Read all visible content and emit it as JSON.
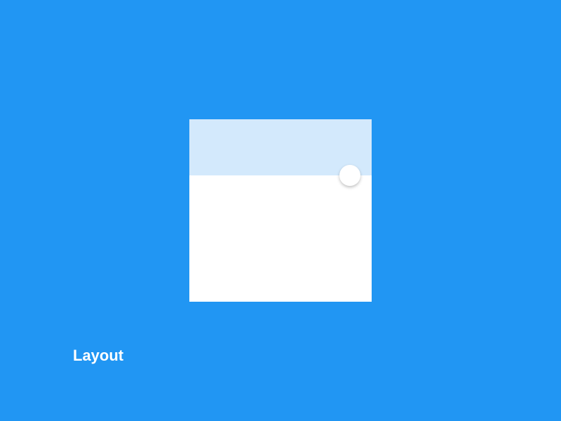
{
  "colors": {
    "background": "#2196F3",
    "card": "#FFFFFF",
    "card_header": "#D3E9FC"
  },
  "label": "Layout"
}
